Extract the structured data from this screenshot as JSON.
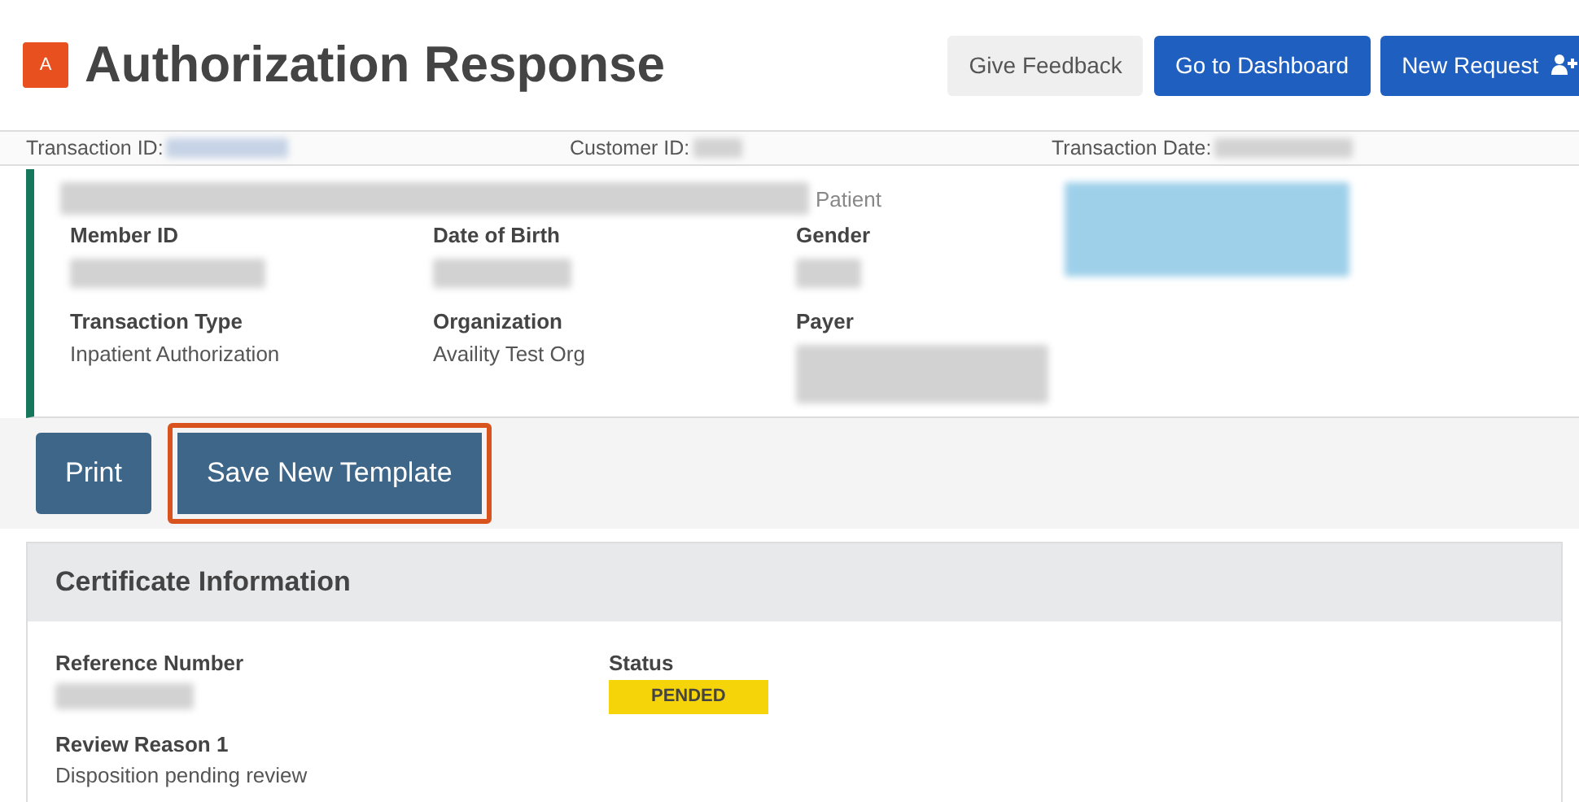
{
  "header": {
    "logo": "A",
    "title": "Authorization Response",
    "buttons": [
      {
        "label": "Give Feedback",
        "kind": "light"
      },
      {
        "label": "Go to Dashboard",
        "kind": "primary"
      },
      {
        "label": "New Request",
        "kind": "primary-icon"
      }
    ]
  },
  "transaction_bar": [
    {
      "label": "Transaction ID:"
    },
    {
      "label": "Customer ID:"
    },
    {
      "label": "Transaction Date:"
    }
  ],
  "patient_card": {
    "patient_label": "Patient",
    "fields": [
      {
        "label": "Member ID"
      },
      {
        "label": "Date of Birth"
      },
      {
        "label": "Gender"
      },
      {
        "label": "Transaction Type",
        "value": "Inpatient Authorization"
      },
      {
        "label": "Organization",
        "value": "Availity Test Org"
      },
      {
        "label": "Payer"
      }
    ]
  },
  "actions": [
    {
      "label": "Print",
      "highlighted": false
    },
    {
      "label": "Save New Template",
      "highlighted": true
    }
  ],
  "certificate": {
    "title": "Certificate Information",
    "fields": [
      {
        "label": "Reference Number",
        "kind": "redacted"
      },
      {
        "label": "Status",
        "kind": "badge",
        "value": "PENDED"
      },
      {
        "label": "Review Reason 1",
        "kind": "text",
        "value": "Disposition pending review"
      }
    ]
  }
}
